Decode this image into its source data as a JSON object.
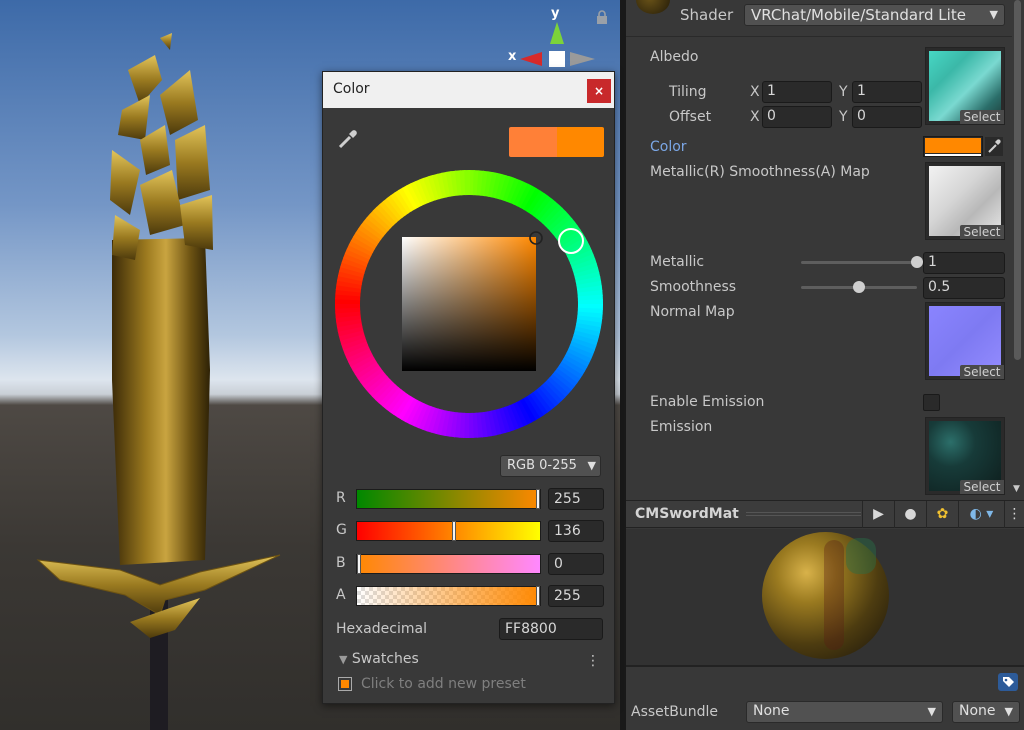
{
  "scene": {
    "gizmo": {
      "x_label": "x",
      "y_label": "y"
    }
  },
  "color_window": {
    "title": "Color",
    "close_glyph": "×",
    "mode": "RGB 0-255",
    "channels": [
      {
        "label": "R",
        "value": "255",
        "fraction": 1.0
      },
      {
        "label": "G",
        "value": "136",
        "fraction": 0.533
      },
      {
        "label": "B",
        "value": "0",
        "fraction": 0.0
      },
      {
        "label": "A",
        "value": "255",
        "fraction": 1.0
      }
    ],
    "hex_label": "Hexadecimal",
    "hex_value": "FF8800",
    "swatches_label": "Swatches",
    "swatches_menu": "⋮",
    "preset_hint": "Click to add new preset",
    "new_color": "#ff8037",
    "old_color": "#ff8800"
  },
  "inspector": {
    "shader_label": "Shader",
    "shader_value": "VRChat/Mobile/Standard Lite",
    "albedo_label": "Albedo",
    "tiling_label": "Tiling",
    "offset_label": "Offset",
    "x_label": "X",
    "y_label": "Y",
    "tiling_x": "1",
    "tiling_y": "1",
    "offset_x": "0",
    "offset_y": "0",
    "color_label": "Color",
    "color_value": "#ff8800",
    "metallic_map_label": "Metallic(R) Smoothness(A) Map",
    "metallic_label": "Metallic",
    "metallic_value": "1",
    "metallic_fraction": 1.0,
    "smoothness_label": "Smoothness",
    "smoothness_value": "0.5",
    "smoothness_fraction": 0.5,
    "normal_map_label": "Normal Map",
    "enable_emission_label": "Enable Emission",
    "emission_label": "Emission",
    "select_label": "Select"
  },
  "preview": {
    "title": "CMSwordMat",
    "buttons": [
      "▶",
      "●",
      "✿",
      "◐ ▾",
      "⋮"
    ]
  },
  "asset_bundle": {
    "label": "AssetBundle",
    "name_value": "None",
    "variant_value": "None"
  }
}
